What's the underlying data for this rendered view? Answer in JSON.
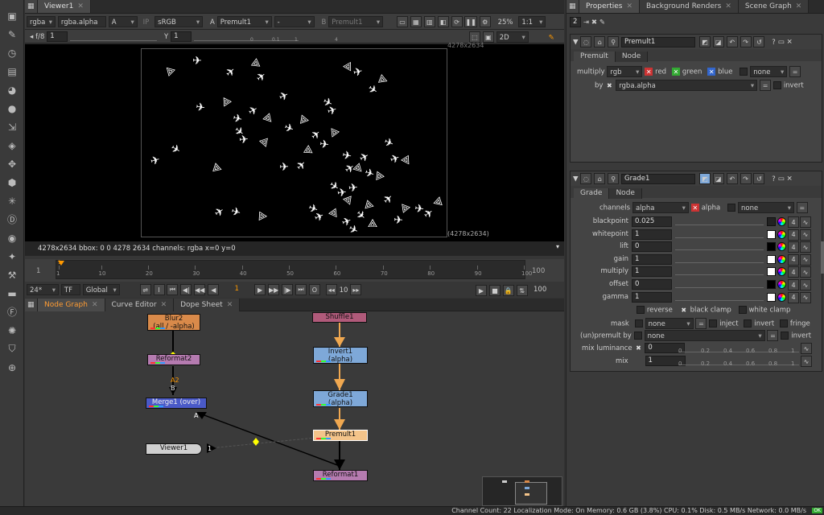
{
  "viewer": {
    "tab": "Viewer1",
    "channels": "rgba",
    "channel_alpha": "rgba.alpha",
    "display": "A",
    "ip": "IP",
    "lut": "sRGB",
    "input_a_label": "A",
    "input_a": "Premult1",
    "wipe": "-",
    "input_b_label": "B",
    "input_b": "Premult1",
    "zoom": "25%",
    "ratio": "1:1",
    "fstop": "f/8",
    "gain_value": "1",
    "y_label": "Y",
    "gamma_value": "1",
    "gain_ticks": [
      "0",
      "0.1",
      "1",
      "4"
    ],
    "mode_2d": "2D",
    "format_top": "4278x2634",
    "format_bottom": "(4278x2634)",
    "info": "4278x2634  bbox: 0 0 4278 2634 channels: rgba    x=0 y=0"
  },
  "timeline": {
    "start": "1",
    "end": "100",
    "current": "1",
    "ticks": [
      "1",
      "10",
      "20",
      "30",
      "40",
      "50",
      "60",
      "70",
      "80",
      "90",
      "100"
    ],
    "fps": "24*",
    "tf": "TF",
    "scope": "Global",
    "step": "10",
    "end_frame": "100",
    "playhead_label": "1"
  },
  "graph_tabs": [
    "Node Graph",
    "Curve Editor",
    "Dope Sheet"
  ],
  "nodes": {
    "blur": "Blur2\n(all / -alpha)",
    "reformat2": "Reformat2",
    "merge": "Merge1 (over)",
    "viewer": "Viewer1",
    "shuffle": "Shuffle1",
    "invert": "Invert1\n(alpha)",
    "grade": "Grade1\n(alpha)",
    "premult": "Premult1",
    "reformat1": "Reformat1",
    "input_a2": "A2",
    "input_b": "B",
    "input_a": "A",
    "viewer_input": "1"
  },
  "right_tabs": [
    "Properties",
    "Background Renders",
    "Scene Graph"
  ],
  "props_count": "2",
  "premult_panel": {
    "name": "Premult1",
    "tabs": [
      "Premult",
      "Node"
    ],
    "multiply_label": "multiply",
    "multiply_value": "rgb",
    "red": "red",
    "green": "green",
    "blue": "blue",
    "extra": "none",
    "by_label": "by",
    "by_value": "rgba.alpha",
    "invert": "invert"
  },
  "grade_panel": {
    "name": "Grade1",
    "tabs": [
      "Grade",
      "Node"
    ],
    "channels_label": "channels",
    "channels_value": "alpha",
    "alpha": "alpha",
    "extra": "none",
    "params": [
      {
        "label": "blackpoint",
        "value": "0.025",
        "swatch": "#222222"
      },
      {
        "label": "whitepoint",
        "value": "1",
        "swatch": "#ffffff"
      },
      {
        "label": "lift",
        "value": "0",
        "swatch": "#000000"
      },
      {
        "label": "gain",
        "value": "1",
        "swatch": "#ffffff"
      },
      {
        "label": "multiply",
        "value": "1",
        "swatch": "#ffffff"
      },
      {
        "label": "offset",
        "value": "0",
        "swatch": "#000000"
      },
      {
        "label": "gamma",
        "value": "1",
        "swatch": "#ffffff"
      }
    ],
    "four": "4",
    "reverse": "reverse",
    "black_clamp": "black clamp",
    "white_clamp": "white clamp",
    "mask_label": "mask",
    "mask_value": "none",
    "inject": "inject",
    "mask_invert": "invert",
    "fringe": "fringe",
    "unpremult_label": "(un)premult by",
    "unpremult_value": "none",
    "unpremult_invert": "invert",
    "mixlum_label": "mix luminance",
    "mixlum_value": "0",
    "mix_label": "mix",
    "mix_value": "1",
    "slider_ticks": [
      "0",
      "0.2",
      "0.4",
      "0.6",
      "0.8",
      "1"
    ]
  },
  "status": "Channel Count: 22  Localization Mode: On  Memory: 0.6 GB (3.8%)  CPU: 0.1%  Disk: 0.5 MB/s  Network: 0.0 MB/s",
  "status_badge": "OK"
}
